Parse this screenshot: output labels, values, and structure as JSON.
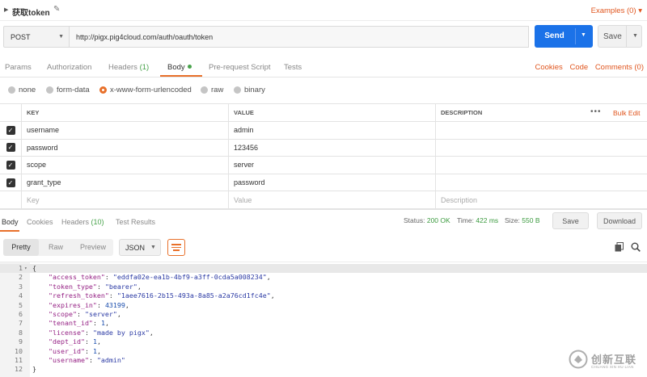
{
  "request": {
    "name": "获取token",
    "examples_label": "Examples (0)",
    "method": "POST",
    "url": "http://pigx.pig4cloud.com/auth/oauth/token",
    "send_label": "Send",
    "save_label": "Save"
  },
  "request_tabs": {
    "params": "Params",
    "authorization": "Authorization",
    "headers": "Headers",
    "headers_count": "(1)",
    "body": "Body",
    "prerequest": "Pre-request Script",
    "tests": "Tests",
    "cookies": "Cookies",
    "code": "Code",
    "comments": "Comments (0)"
  },
  "body_types": {
    "none": "none",
    "form_data": "form-data",
    "urlencoded": "x-www-form-urlencoded",
    "raw": "raw",
    "binary": "binary",
    "selected": "x-www-form-urlencoded"
  },
  "params_table": {
    "headers": {
      "key": "KEY",
      "value": "VALUE",
      "description": "DESCRIPTION",
      "bulk_edit": "Bulk Edit"
    },
    "rows": [
      {
        "key": "username",
        "value": "admin",
        "checked": true
      },
      {
        "key": "password",
        "value": "123456",
        "checked": true
      },
      {
        "key": "scope",
        "value": "server",
        "checked": true
      },
      {
        "key": "grant_type",
        "value": "password",
        "checked": true
      }
    ],
    "placeholder": {
      "key": "Key",
      "value": "Value",
      "description": "Description"
    }
  },
  "response": {
    "tabs": {
      "body": "Body",
      "cookies": "Cookies",
      "headers": "Headers",
      "headers_count": "(10)",
      "test_results": "Test Results"
    },
    "status_label": "Status:",
    "status_value": "200 OK",
    "time_label": "Time:",
    "time_value": "422 ms",
    "size_label": "Size:",
    "size_value": "550 B",
    "save_label": "Save",
    "download_label": "Download",
    "view_modes": {
      "pretty": "Pretty",
      "raw": "Raw",
      "preview": "Preview"
    },
    "format": "JSON"
  },
  "response_body_lines": [
    {
      "n": "1",
      "parts": [
        [
          "p",
          "{"
        ]
      ]
    },
    {
      "n": "2",
      "parts": [
        [
          "p",
          "    "
        ],
        [
          "k",
          "\"access_token\""
        ],
        [
          "p",
          ": "
        ],
        [
          "s",
          "\"eddfa02e-ea1b-4bf9-a3ff-0cda5a008234\""
        ],
        [
          "p",
          ","
        ]
      ]
    },
    {
      "n": "3",
      "parts": [
        [
          "p",
          "    "
        ],
        [
          "k",
          "\"token_type\""
        ],
        [
          "p",
          ": "
        ],
        [
          "s",
          "\"bearer\""
        ],
        [
          "p",
          ","
        ]
      ]
    },
    {
      "n": "4",
      "parts": [
        [
          "p",
          "    "
        ],
        [
          "k",
          "\"refresh_token\""
        ],
        [
          "p",
          ": "
        ],
        [
          "s",
          "\"1aee7616-2b15-493a-8a85-a2a76cd1fc4e\""
        ],
        [
          "p",
          ","
        ]
      ]
    },
    {
      "n": "5",
      "parts": [
        [
          "p",
          "    "
        ],
        [
          "k",
          "\"expires_in\""
        ],
        [
          "p",
          ": "
        ],
        [
          "n",
          "43199"
        ],
        [
          "p",
          ","
        ]
      ]
    },
    {
      "n": "6",
      "parts": [
        [
          "p",
          "    "
        ],
        [
          "k",
          "\"scope\""
        ],
        [
          "p",
          ": "
        ],
        [
          "s",
          "\"server\""
        ],
        [
          "p",
          ","
        ]
      ]
    },
    {
      "n": "7",
      "parts": [
        [
          "p",
          "    "
        ],
        [
          "k",
          "\"tenant_id\""
        ],
        [
          "p",
          ": "
        ],
        [
          "n",
          "1"
        ],
        [
          "p",
          ","
        ]
      ]
    },
    {
      "n": "8",
      "parts": [
        [
          "p",
          "    "
        ],
        [
          "k",
          "\"license\""
        ],
        [
          "p",
          ": "
        ],
        [
          "s",
          "\"made by pigx\""
        ],
        [
          "p",
          ","
        ]
      ]
    },
    {
      "n": "9",
      "parts": [
        [
          "p",
          "    "
        ],
        [
          "k",
          "\"dept_id\""
        ],
        [
          "p",
          ": "
        ],
        [
          "n",
          "1"
        ],
        [
          "p",
          ","
        ]
      ]
    },
    {
      "n": "10",
      "parts": [
        [
          "p",
          "    "
        ],
        [
          "k",
          "\"user_id\""
        ],
        [
          "p",
          ": "
        ],
        [
          "n",
          "1"
        ],
        [
          "p",
          ","
        ]
      ]
    },
    {
      "n": "11",
      "parts": [
        [
          "p",
          "    "
        ],
        [
          "k",
          "\"username\""
        ],
        [
          "p",
          ": "
        ],
        [
          "s",
          "\"admin\""
        ]
      ]
    },
    {
      "n": "12",
      "parts": [
        [
          "p",
          "}"
        ]
      ]
    }
  ],
  "watermark": {
    "text": "创新互联",
    "subtext": "CHUANG XIN HU LIAN"
  },
  "icons": {
    "caret": "caret-down-icon",
    "edit": "pencil-icon",
    "more": "more-icon",
    "wrap": "wrap-lines-icon",
    "copy": "copy-icon",
    "search": "search-icon"
  },
  "colors": {
    "accent": "#e8702a",
    "send": "#1b72e8",
    "success": "#48a34b",
    "json_key": "#941f83",
    "json_string": "#2b3aa4"
  }
}
